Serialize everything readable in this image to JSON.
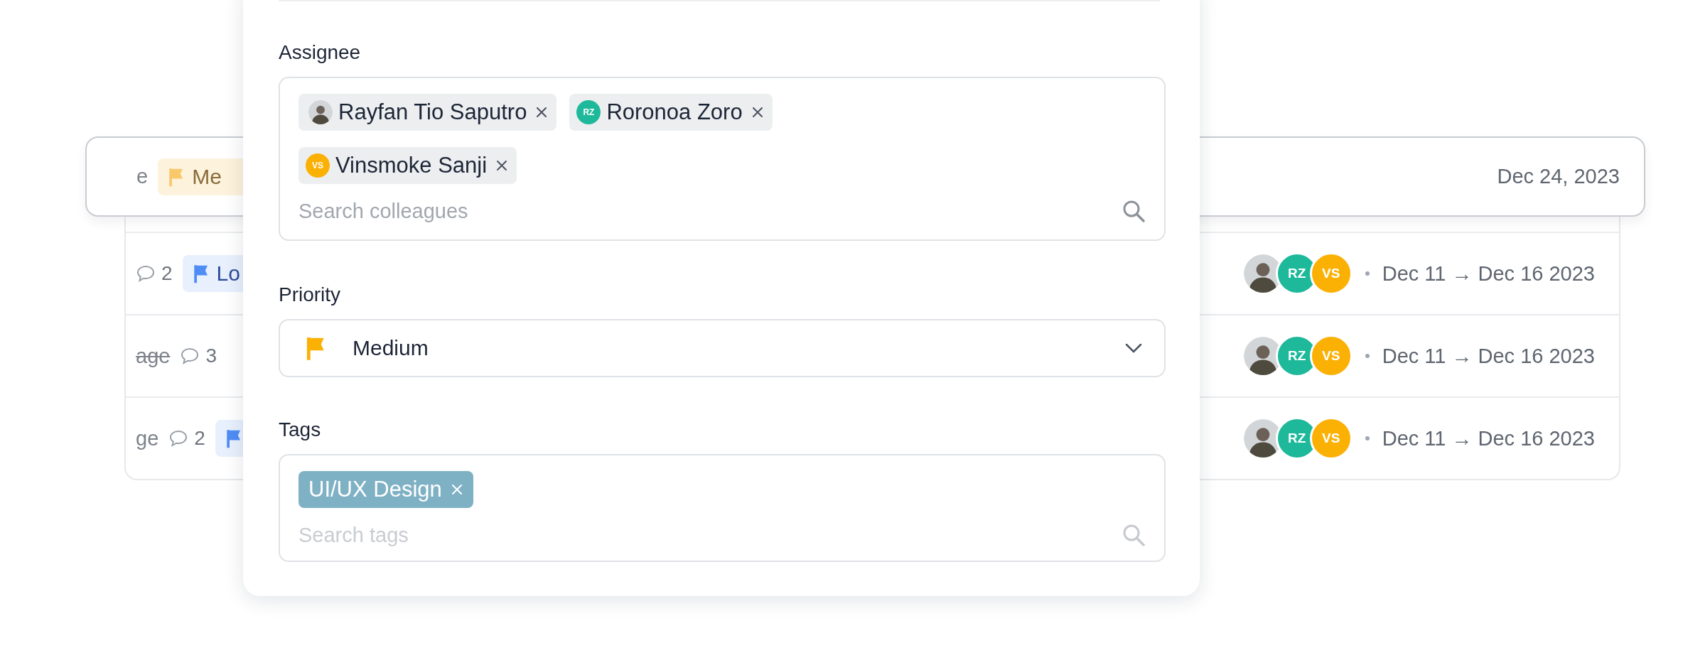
{
  "task_rows": [
    {
      "kind": "dragged",
      "title_fragment": "e",
      "done": false,
      "priority": {
        "label": "Me",
        "kind": "medium"
      },
      "date": "Dec 24, 2023"
    },
    {
      "kind": "row",
      "comments": "2",
      "priority": {
        "label": "Lo",
        "kind": "low"
      },
      "assignees": [
        {
          "kind": "photo"
        },
        {
          "kind": "initials",
          "initials": "RZ",
          "color": "#1db99a"
        },
        {
          "kind": "initials",
          "initials": "VS",
          "color": "#fbb004"
        }
      ],
      "date": "Dec 11 → Dec 16 2023"
    },
    {
      "kind": "row",
      "title_fragment": "age",
      "done": true,
      "comments": "3",
      "assignees": [
        {
          "kind": "photo"
        },
        {
          "kind": "initials",
          "initials": "RZ",
          "color": "#1db99a"
        },
        {
          "kind": "initials",
          "initials": "VS",
          "color": "#fbb004"
        }
      ],
      "date": "Dec 11 → Dec 16 2023"
    },
    {
      "kind": "row",
      "title_fragment": "ge",
      "done": false,
      "comments": "2",
      "priority": {
        "kind": "low"
      },
      "assignees": [
        {
          "kind": "photo"
        },
        {
          "kind": "initials",
          "initials": "RZ",
          "color": "#1db99a"
        },
        {
          "kind": "initials",
          "initials": "VS",
          "color": "#fbb004"
        }
      ],
      "date": "Dec 11 → Dec 16 2023"
    }
  ],
  "form": {
    "assignee": {
      "label": "Assignee",
      "chips": [
        {
          "name": "Rayfan Tio Saputro",
          "avatar": {
            "kind": "photo"
          }
        },
        {
          "name": "Roronoa Zoro",
          "avatar": {
            "kind": "initials",
            "initials": "RZ",
            "color": "#1db99a"
          }
        },
        {
          "name": "Vinsmoke Sanji",
          "avatar": {
            "kind": "initials",
            "initials": "VS",
            "color": "#fbb004"
          }
        }
      ],
      "placeholder": "Search colleagues"
    },
    "priority": {
      "label": "Priority",
      "value": "Medium",
      "kind": "medium"
    },
    "tags": {
      "label": "Tags",
      "chips": [
        {
          "name": "UI/UX Design",
          "color": "#7fb1c5"
        }
      ],
      "placeholder": "Search tags"
    }
  }
}
